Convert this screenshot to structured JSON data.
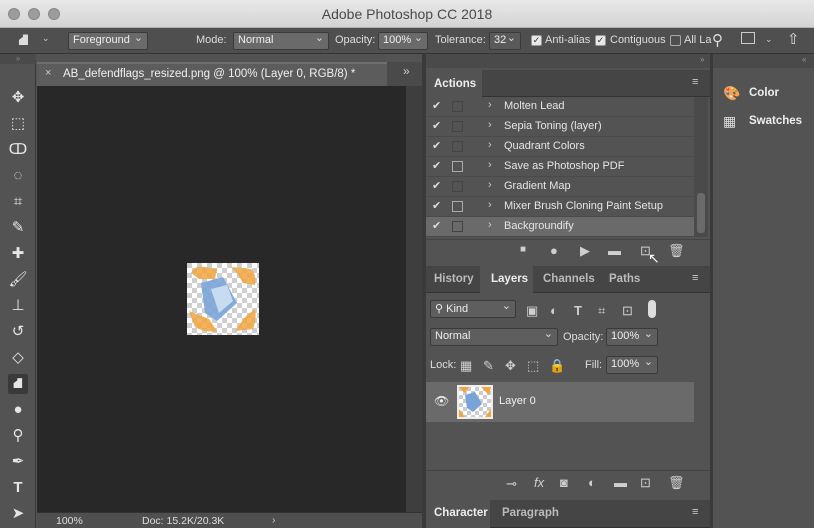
{
  "window": {
    "title": "Adobe Photoshop CC 2018"
  },
  "options_bar": {
    "fill_source": "Foreground",
    "mode_label": "Mode:",
    "mode_value": "Normal",
    "opacity_label": "Opacity:",
    "opacity_value": "100%",
    "tolerance_label": "Tolerance:",
    "tolerance_value": "32",
    "antialias_label": "Anti-alias",
    "contiguous_label": "Contiguous",
    "all_layers_label": "All La"
  },
  "document": {
    "tab_title": "AB_defendflags_resized.png @ 100% (Layer 0, RGB/8) *",
    "zoom": "100%",
    "doc_info": "Doc: 15.2K/20.3K"
  },
  "actions_panel": {
    "title": "Actions",
    "items": [
      {
        "label": "Molten Lead",
        "checked": true
      },
      {
        "label": "Sepia Toning (layer)",
        "checked": true
      },
      {
        "label": "Quadrant Colors",
        "checked": true
      },
      {
        "label": "Save as Photoshop PDF",
        "checked": true
      },
      {
        "label": "Gradient Map",
        "checked": true
      },
      {
        "label": "Mixer Brush Cloning Paint Setup",
        "checked": true
      },
      {
        "label": "Backgroundify",
        "checked": true
      }
    ]
  },
  "layers_panel": {
    "tabs": [
      "History",
      "Layers",
      "Channels",
      "Paths"
    ],
    "active_tab": "Layers",
    "filter": "Kind",
    "blend_mode": "Normal",
    "opacity_label": "Opacity:",
    "opacity_value": "100%",
    "lock_label": "Lock:",
    "fill_label": "Fill:",
    "fill_value": "100%",
    "layer_name": "Layer 0"
  },
  "bottom_panel": {
    "tabs": [
      "Character",
      "Paragraph"
    ]
  },
  "right_panel": {
    "color_label": "Color",
    "swatches_label": "Swatches"
  }
}
